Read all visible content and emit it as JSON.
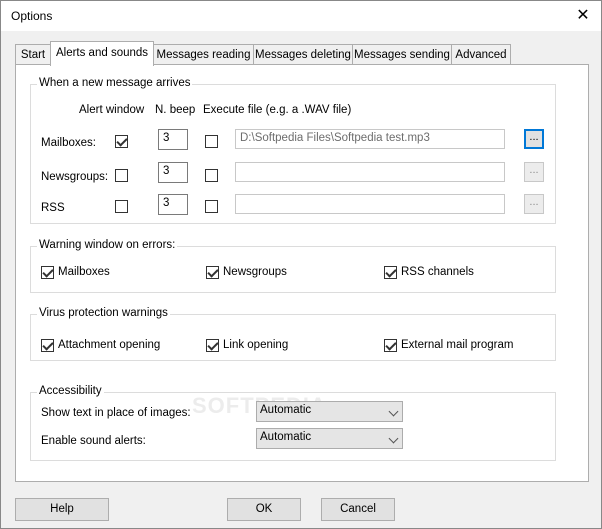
{
  "window": {
    "title": "Options",
    "close_glyph": "✕"
  },
  "tabs": [
    {
      "label": "Start"
    },
    {
      "label": "Alerts and sounds"
    },
    {
      "label": "Messages reading"
    },
    {
      "label": "Messages deleting"
    },
    {
      "label": "Messages sending"
    },
    {
      "label": "Advanced"
    }
  ],
  "new_message": {
    "legend": "When a new message arrives",
    "col_alert": "Alert window",
    "col_beep": "N. beep",
    "col_exec": "Execute file (e.g. a .WAV file)",
    "rows": [
      {
        "label": "Mailboxes:",
        "alert": true,
        "beep": "3",
        "exec": false,
        "file": "D:\\Softpedia Files\\Softpedia test.mp3",
        "browse": "..."
      },
      {
        "label": "Newsgroups:",
        "alert": false,
        "beep": "3",
        "exec": false,
        "file": "",
        "browse": "..."
      },
      {
        "label": "RSS",
        "alert": false,
        "beep": "3",
        "exec": false,
        "file": "",
        "browse": "..."
      }
    ]
  },
  "warning": {
    "legend": "Warning window on errors:",
    "items": [
      {
        "label": "Mailboxes",
        "checked": true
      },
      {
        "label": "Newsgroups",
        "checked": true
      },
      {
        "label": "RSS channels",
        "checked": true
      }
    ]
  },
  "virus": {
    "legend": "Virus protection warnings",
    "items": [
      {
        "label": "Attachment opening",
        "checked": true
      },
      {
        "label": "Link opening",
        "checked": true
      },
      {
        "label": "External mail program",
        "checked": true
      }
    ]
  },
  "accessibility": {
    "legend": "Accessibility",
    "show_text_label": "Show text in place of images:",
    "show_text_value": "Automatic",
    "sound_label": "Enable sound alerts:",
    "sound_value": "Automatic"
  },
  "buttons": {
    "help": "Help",
    "ok": "OK",
    "cancel": "Cancel"
  },
  "watermark": "SOFTPEDIA"
}
